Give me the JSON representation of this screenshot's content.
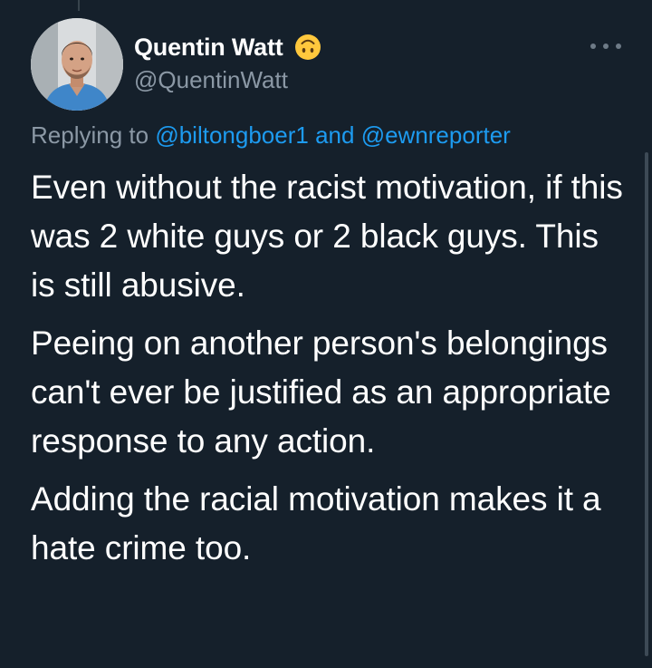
{
  "tweet": {
    "author": {
      "display_name": "Quentin Watt",
      "handle": "@QuentinWatt",
      "status_emoji": "upside-down-face-emoji"
    },
    "more_icon": "more-horizontal-icon",
    "replying_to": {
      "prefix": "Replying to",
      "mention_1": "@biltongboer1",
      "conjunction": "and",
      "mention_2": "@ewnreporter"
    },
    "paragraphs": [
      "Even without the racist motivation, if this was 2 white guys or 2 black guys. This is still abusive.",
      "Peeing on another person's belongings can't ever be justified as an appropriate response to any action.",
      "Adding the racial motivation makes it a hate crime too."
    ]
  },
  "colors": {
    "background": "#15202b",
    "primary_text": "#ffffff",
    "secondary_text": "#8b98a5",
    "link": "#1d9bf0",
    "emoji": "#ffc83d"
  }
}
